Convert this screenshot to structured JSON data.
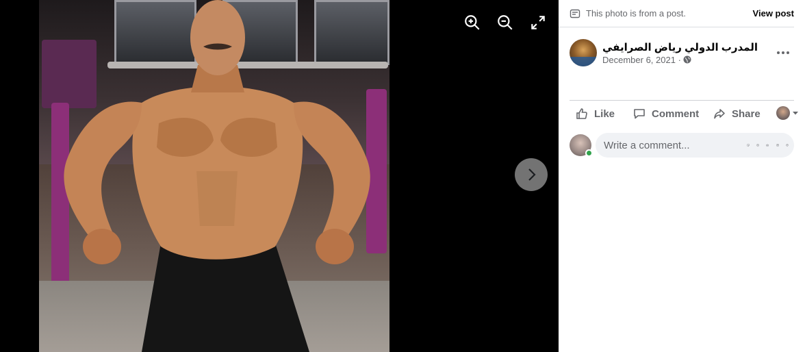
{
  "viewer": {
    "zoom_in_icon": "zoom-in-icon",
    "zoom_out_icon": "zoom-out-icon",
    "fullscreen_icon": "expand-icon",
    "next_icon": "chevron-right-icon"
  },
  "panel": {
    "notice_text": "This photo is from a post.",
    "view_post_label": "View post",
    "author_name": "المدرب الدولي رياض الصرايفي",
    "post_date": "December 6, 2021 ·",
    "privacy_icon": "globe-icon",
    "more_icon": "more-horizontal-icon"
  },
  "actions": {
    "like_label": "Like",
    "comment_label": "Comment",
    "share_label": "Share"
  },
  "comment": {
    "placeholder": "Write a comment...",
    "icons": [
      "sticker-icon",
      "emoji-icon",
      "camera-icon",
      "gif-icon",
      "avatar-sticker-icon"
    ]
  },
  "colors": {
    "viewer_bg": "#000000",
    "secondary_text": "#65676b",
    "online": "#31a24c",
    "input_bg": "#f0f2f5"
  }
}
